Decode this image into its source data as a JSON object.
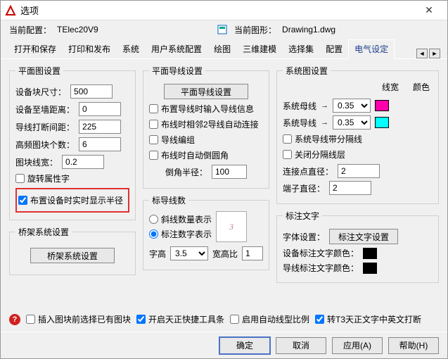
{
  "window": {
    "title": "选项",
    "close": "✕"
  },
  "profile": {
    "label": "当前配置：",
    "value": "TElec20V9",
    "drawing_label": "当前图形：",
    "drawing_value": "Drawing1.dwg"
  },
  "tabs": {
    "items": [
      "打开和保存",
      "打印和发布",
      "系统",
      "用户系统配置",
      "绘图",
      "三维建模",
      "选择集",
      "配置",
      "电气设定"
    ],
    "active": 8,
    "nav_left": "◄",
    "nav_right": "►"
  },
  "plan": {
    "legend": "平面图设置",
    "block_size_lbl": "设备块尺寸：",
    "block_size": "500",
    "wall_dist_lbl": "设备至墙距离：",
    "wall_dist": "0",
    "break_dist_lbl": "导线打断间距：",
    "break_dist": "225",
    "hf_count_lbl": "高频图块个数：",
    "hf_count": "6",
    "block_lw_lbl": "图块线宽：",
    "block_lw": "0.2",
    "rotate_attr": "旋转属性字",
    "realtime_radius": "布置设备时实时显示半径"
  },
  "bridge": {
    "legend": "桥架系统设置",
    "btn": "桥架系统设置"
  },
  "wire": {
    "legend": "平面导线设置",
    "btn": "平面导线设置",
    "input_info": "布置导线时输入导线信息",
    "adj2": "布线时相邻2导线自动连接",
    "compile": "导线编组",
    "auto_fillet": "布线时自动倒圆角",
    "fillet_r_lbl": "倒角半径：",
    "fillet_r": "100"
  },
  "labelnum": {
    "legend": "标导线数",
    "radio_sl": "斜线数量表示",
    "radio_num": "标注数字表示",
    "preview": "3",
    "height_lbl": "字高",
    "height": "3.5",
    "ratio_lbl": "宽高比",
    "ratio": "1"
  },
  "sys": {
    "legend": "系统图设置",
    "lw_hdr": "线宽",
    "color_hdr": "颜色",
    "bus_lbl": "系统母线",
    "bus_lw": "0.35",
    "bus_color": "#ff00aa",
    "wire_lbl": "系统导线",
    "wire_lw": "0.35",
    "wire_color": "#00ffff",
    "sep": "系统导线带分隔线",
    "close_layer": "关闭分隔线层",
    "conn_d_lbl": "连接点直径：",
    "conn_d": "2",
    "term_d_lbl": "端子直径：",
    "term_d": "2"
  },
  "labeltxt": {
    "legend": "标注文字",
    "font_lbl": "字体设置：",
    "font_btn": "标注文字设置",
    "dev_color_lbl": "设备标注文字颜色：",
    "dev_color": "#000000",
    "wire_color_lbl": "导线标注文字颜色：",
    "wire_color": "#000000"
  },
  "bottom": {
    "existing": "插入图块前选择已有图块",
    "fastbar": "开启天正快捷工具条",
    "auto_lt": "启用自动线型比例",
    "t3": "转T3天正文字中英文打断"
  },
  "footer": {
    "ok": "确定",
    "cancel": "取消",
    "apply": "应用(A)",
    "help": "帮助(H)"
  }
}
